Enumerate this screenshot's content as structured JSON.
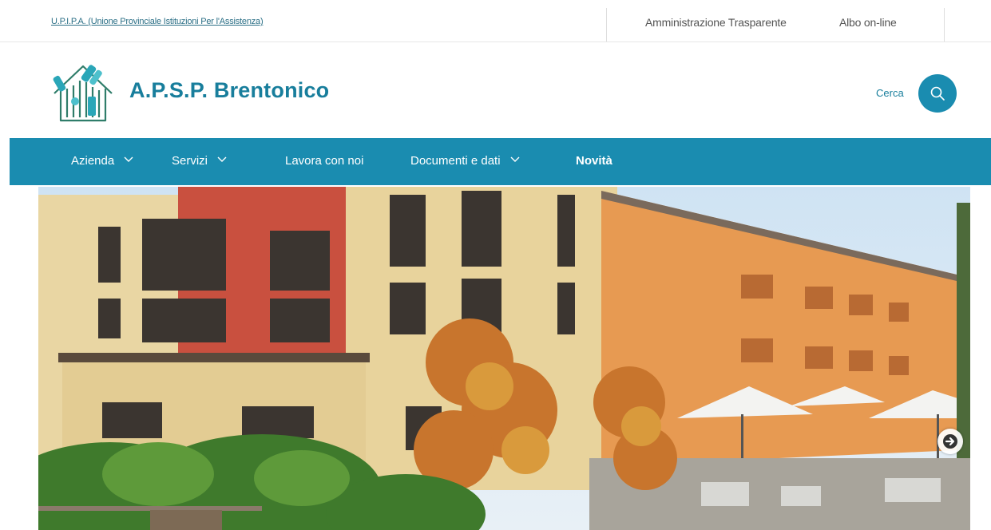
{
  "topbar": {
    "org_link": "U.P.I.P.A. (Unione Provinciale Istituzioni Per l'Assistenza)",
    "links": [
      "Amministrazione Trasparente",
      "Albo on-line"
    ]
  },
  "header": {
    "title": "A.P.S.P. Brentonico",
    "search_label": "Cerca",
    "logo_icon": "house-hands-logo-icon",
    "search_icon": "search-icon"
  },
  "nav": {
    "items": [
      {
        "label": "Azienda",
        "dropdown": true
      },
      {
        "label": "Servizi",
        "dropdown": true
      },
      {
        "label": "Lavora con noi",
        "dropdown": false
      },
      {
        "label": "Documenti e dati",
        "dropdown": true
      },
      {
        "label": "Novità",
        "dropdown": false
      }
    ]
  },
  "hero": {
    "next_icon": "arrow-right-icon"
  },
  "colors": {
    "brand": "#1a8cb0",
    "title": "#187e9c",
    "nav_text": "#ffffff"
  }
}
